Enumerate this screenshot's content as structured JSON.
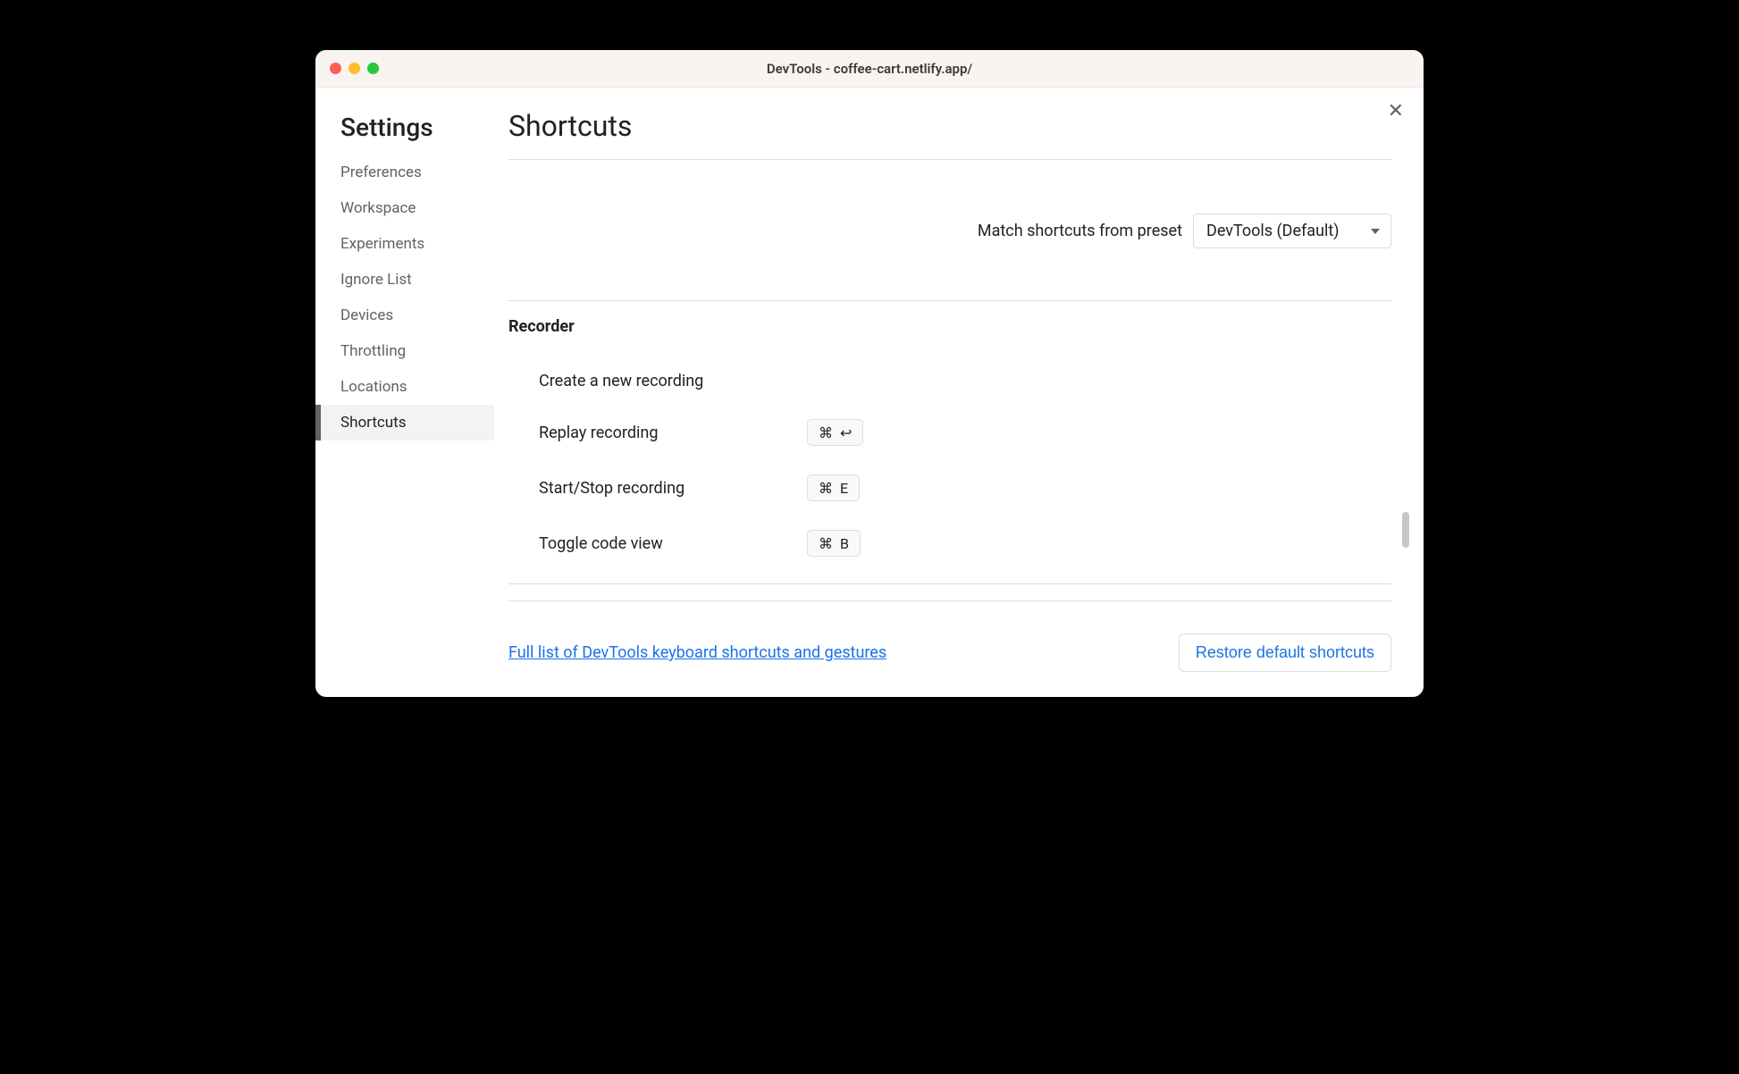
{
  "window": {
    "title": "DevTools - coffee-cart.netlify.app/"
  },
  "sidebar": {
    "heading": "Settings",
    "items": [
      {
        "label": "Preferences",
        "selected": false
      },
      {
        "label": "Workspace",
        "selected": false
      },
      {
        "label": "Experiments",
        "selected": false
      },
      {
        "label": "Ignore List",
        "selected": false
      },
      {
        "label": "Devices",
        "selected": false
      },
      {
        "label": "Throttling",
        "selected": false
      },
      {
        "label": "Locations",
        "selected": false
      },
      {
        "label": "Shortcuts",
        "selected": true
      }
    ]
  },
  "main": {
    "page_title": "Shortcuts",
    "preset_label": "Match shortcuts from preset",
    "preset_value": "DevTools (Default)",
    "section_heading": "Recorder",
    "shortcuts": [
      {
        "label": "Create a new recording",
        "keys": []
      },
      {
        "label": "Replay recording",
        "keys": [
          "⌘",
          "↩"
        ]
      },
      {
        "label": "Start/Stop recording",
        "keys": [
          "⌘",
          "E"
        ]
      },
      {
        "label": "Toggle code view",
        "keys": [
          "⌘",
          "B"
        ]
      }
    ],
    "footer_link": "Full list of DevTools keyboard shortcuts and gestures",
    "restore_label": "Restore default shortcuts"
  },
  "close_glyph": "✕"
}
